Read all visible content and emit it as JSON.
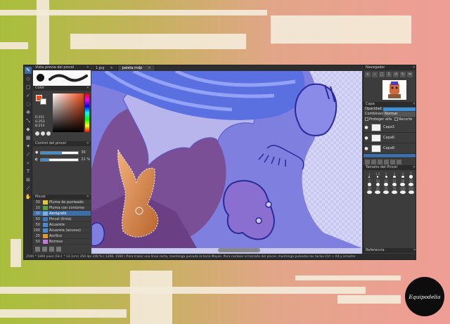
{
  "brush_preview": {
    "title": "Vista previa del pincel"
  },
  "color": {
    "title": "Color",
    "r": "R:251",
    "g": "G:253",
    "b": "B:253",
    "primary": "#f24a15"
  },
  "brush_control": {
    "title": "Control del pincel",
    "size": "30",
    "opacity": "21 %",
    "size_fraction": 0.55,
    "opacity_fraction": 0.21
  },
  "brush_panel": {
    "title": "Pincel",
    "items": [
      {
        "size": "30",
        "name": "Pluma de punteado"
      },
      {
        "size": "10",
        "name": "Pluma con contorno"
      },
      {
        "size": "30",
        "name": "Aerógrafo"
      },
      {
        "size": "50",
        "name": "Pincel (tinta)"
      },
      {
        "size": "50",
        "name": "Acuarela"
      },
      {
        "size": "190",
        "name": "Acuarela (acuoso)"
      },
      {
        "size": "25",
        "name": "Acrílico"
      },
      {
        "size": "50",
        "name": "Borroso"
      }
    ]
  },
  "tabs": [
    {
      "label": "1.jpg"
    },
    {
      "label": "paleta.mdp"
    }
  ],
  "navigator": {
    "title": "Navegador"
  },
  "layers": {
    "title": "Capa",
    "opacity_label": "Opacidad",
    "blend_label": "Combinación",
    "blend_value": "Normal",
    "protect_alpha": "Proteger alfa",
    "clip": "Recorte",
    "items": [
      {
        "name": "Capa3"
      },
      {
        "name": "Capa6"
      },
      {
        "name": "Capa8"
      }
    ]
  },
  "brush_size": {
    "title": "Tamaño del Pincel",
    "values": [
      "1",
      "1.5",
      "2",
      "3",
      "4",
      "5",
      "7",
      "10",
      "12",
      "15",
      "20",
      "25",
      "30",
      "40",
      "50",
      "70",
      "100",
      "150"
    ]
  },
  "reference": {
    "title": "Referencia"
  },
  "status": {
    "text": "2500 * 1800 pixel  (18.1 * 13.1cm)  350 dpi  100 %  ( 1266, 1560 )  Para trazar una línea recta, mantenga pulsada la tecla Mayús. Para cambiar el tamaño del pincel, mantenga pulsadas las teclas Ctrl + Alt y arrastre"
  },
  "watermark": {
    "text": "Equipodelia"
  }
}
